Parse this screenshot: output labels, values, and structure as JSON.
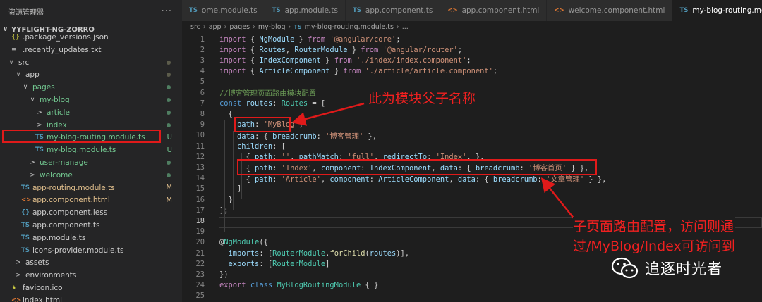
{
  "sidebar": {
    "title": "资源管理器",
    "more": "···",
    "project": "YYFLIGHT-NG-ZORRO",
    "items": [
      {
        "label": ".package_versions.json",
        "icon": "{}",
        "icon_class": "ico-json",
        "indent": 16,
        "status": ""
      },
      {
        "label": ".recently_updates.txt",
        "icon": "≡",
        "icon_class": "ico-txt",
        "indent": 16,
        "status": ""
      },
      {
        "label": "src",
        "chev": "∨",
        "icon": "",
        "icon_class": "",
        "indent": 10,
        "status": "",
        "dot": "dim",
        "label_class": ""
      },
      {
        "label": "app",
        "chev": "∨",
        "icon": "",
        "indent": 20,
        "dot": "dim"
      },
      {
        "label": "pages",
        "chev": "∨",
        "icon": "",
        "indent": 30,
        "dot": "green",
        "label_class": "c-green"
      },
      {
        "label": "my-blog",
        "chev": "∨",
        "icon": "",
        "indent": 40,
        "dot": "green",
        "label_class": "c-green"
      },
      {
        "label": "article",
        "chev": ">",
        "icon": "",
        "indent": 50,
        "dot": "green",
        "label_class": "c-green"
      },
      {
        "label": "index",
        "chev": ">",
        "icon": "",
        "indent": 50,
        "dot": "green",
        "label_class": "c-green"
      },
      {
        "label": "my-blog-routing.module.ts",
        "icon": "TS",
        "icon_class": "ico-ts",
        "indent": 50,
        "status": "U",
        "label_class": "c-green",
        "status_class": "c-green"
      },
      {
        "label": "my-blog.module.ts",
        "icon": "TS",
        "icon_class": "ico-ts",
        "indent": 50,
        "status": "U",
        "label_class": "c-green",
        "status_class": "c-green"
      },
      {
        "label": "user-manage",
        "chev": ">",
        "icon": "",
        "indent": 40,
        "dot": "green",
        "label_class": "c-green"
      },
      {
        "label": "welcome",
        "chev": ">",
        "icon": "",
        "indent": 40,
        "dot": "green",
        "label_class": "c-green"
      },
      {
        "label": "app-routing.module.ts",
        "icon": "TS",
        "icon_class": "ico-ts",
        "indent": 30,
        "status": "M",
        "label_class": "c-yellow",
        "status_class": "c-yellow"
      },
      {
        "label": "app.component.html",
        "icon": "<>",
        "icon_class": "ico-html",
        "indent": 30,
        "status": "M",
        "label_class": "c-yellow",
        "status_class": "c-yellow"
      },
      {
        "label": "app.component.less",
        "icon": "{}",
        "icon_class": "ico-css",
        "indent": 30,
        "status": ""
      },
      {
        "label": "app.component.ts",
        "icon": "TS",
        "icon_class": "ico-ts",
        "indent": 30,
        "status": ""
      },
      {
        "label": "app.module.ts",
        "icon": "TS",
        "icon_class": "ico-ts",
        "indent": 30,
        "status": ""
      },
      {
        "label": "icons-provider.module.ts",
        "icon": "TS",
        "icon_class": "ico-ts",
        "indent": 30,
        "status": ""
      },
      {
        "label": "assets",
        "chev": ">",
        "icon": "",
        "indent": 20,
        "status": ""
      },
      {
        "label": "environments",
        "chev": ">",
        "icon": "",
        "indent": 20,
        "status": ""
      },
      {
        "label": "favicon.ico",
        "icon": "★",
        "icon_class": "ico-star",
        "indent": 16,
        "status": ""
      },
      {
        "label": "index.html",
        "icon": "<>",
        "icon_class": "ico-html",
        "indent": 16,
        "status": ""
      }
    ]
  },
  "tabs": [
    {
      "label": "ome.module.ts",
      "icon": "TS",
      "icon_class": "ico-ts",
      "active": false
    },
    {
      "label": "app.module.ts",
      "icon": "TS",
      "icon_class": "ico-ts",
      "active": false
    },
    {
      "label": "app.component.ts",
      "icon": "TS",
      "icon_class": "ico-ts",
      "active": false
    },
    {
      "label": "app.component.html",
      "icon": "<>",
      "icon_class": "ico-html",
      "active": false
    },
    {
      "label": "welcome.component.html",
      "icon": "<>",
      "icon_class": "ico-html",
      "active": false
    },
    {
      "label": "my-blog-routing.module.ts",
      "icon": "TS",
      "icon_class": "ico-ts",
      "active": true
    }
  ],
  "breadcrumb": {
    "parts": [
      "src",
      "app",
      "pages",
      "my-blog"
    ],
    "file_icon": "TS",
    "file": "my-blog-routing.module.ts",
    "tail": "..."
  },
  "editor": {
    "current_line": 18,
    "lines": [
      {
        "n": "1",
        "t": [
          [
            "kc",
            "import"
          ],
          [
            "pn",
            " { "
          ],
          [
            "prop",
            "NgModule"
          ],
          [
            "pn",
            " } "
          ],
          [
            "kc",
            "from"
          ],
          [
            "pn",
            " "
          ],
          [
            "str",
            "'@angular/core'"
          ],
          [
            "pn",
            ";"
          ]
        ]
      },
      {
        "n": "2",
        "t": [
          [
            "kc",
            "import"
          ],
          [
            "pn",
            " { "
          ],
          [
            "prop",
            "Routes"
          ],
          [
            "pn",
            ", "
          ],
          [
            "prop",
            "RouterModule"
          ],
          [
            "pn",
            " } "
          ],
          [
            "kc",
            "from"
          ],
          [
            "pn",
            " "
          ],
          [
            "str",
            "'@angular/router'"
          ],
          [
            "pn",
            ";"
          ]
        ]
      },
      {
        "n": "3",
        "t": [
          [
            "kc",
            "import"
          ],
          [
            "pn",
            " { "
          ],
          [
            "prop",
            "IndexComponent"
          ],
          [
            "pn",
            " } "
          ],
          [
            "kc",
            "from"
          ],
          [
            "pn",
            " "
          ],
          [
            "str",
            "'./index/index.component'"
          ],
          [
            "pn",
            ";"
          ]
        ]
      },
      {
        "n": "4",
        "t": [
          [
            "kc",
            "import"
          ],
          [
            "pn",
            " { "
          ],
          [
            "prop",
            "ArticleComponent"
          ],
          [
            "pn",
            " } "
          ],
          [
            "kc",
            "from"
          ],
          [
            "pn",
            " "
          ],
          [
            "str",
            "'./article/article.component'"
          ],
          [
            "pn",
            ";"
          ]
        ]
      },
      {
        "n": "5",
        "t": []
      },
      {
        "n": "6",
        "t": [
          [
            "cmt",
            "//博客管理页面路由模块配置"
          ]
        ]
      },
      {
        "n": "7",
        "t": [
          [
            "kw",
            "const"
          ],
          [
            "pn",
            " "
          ],
          [
            "prop",
            "routes"
          ],
          [
            "pn",
            ": "
          ],
          [
            "ty",
            "Routes"
          ],
          [
            "pn",
            " = ["
          ]
        ]
      },
      {
        "n": "8",
        "t": [
          [
            "pn",
            "  {"
          ]
        ]
      },
      {
        "n": "9",
        "t": [
          [
            "pn",
            "    "
          ],
          [
            "prop",
            "path"
          ],
          [
            "pn",
            ": "
          ],
          [
            "str",
            "'MyBlog'"
          ],
          [
            "pn",
            ","
          ]
        ]
      },
      {
        "n": "10",
        "t": [
          [
            "pn",
            "    "
          ],
          [
            "prop",
            "data"
          ],
          [
            "pn",
            ": { "
          ],
          [
            "prop",
            "breadcrumb"
          ],
          [
            "pn",
            ": "
          ],
          [
            "str",
            "'博客管理'"
          ],
          [
            "pn",
            " },"
          ]
        ]
      },
      {
        "n": "11",
        "t": [
          [
            "pn",
            "    "
          ],
          [
            "prop",
            "children"
          ],
          [
            "pn",
            ": ["
          ]
        ]
      },
      {
        "n": "12",
        "t": [
          [
            "pn",
            "      { "
          ],
          [
            "prop",
            "path"
          ],
          [
            "pn",
            ": "
          ],
          [
            "str",
            "''"
          ],
          [
            "pn",
            ", "
          ],
          [
            "prop",
            "pathMatch"
          ],
          [
            "pn",
            ": "
          ],
          [
            "str",
            "'full'"
          ],
          [
            "pn",
            ", "
          ],
          [
            "prop",
            "redirectTo"
          ],
          [
            "pn",
            ": "
          ],
          [
            "str",
            "'Index'"
          ],
          [
            "pn",
            ", },"
          ]
        ]
      },
      {
        "n": "13",
        "t": [
          [
            "pn",
            "      { "
          ],
          [
            "prop",
            "path"
          ],
          [
            "pn",
            ": "
          ],
          [
            "str",
            "'Index'"
          ],
          [
            "pn",
            ", "
          ],
          [
            "prop",
            "component"
          ],
          [
            "pn",
            ": "
          ],
          [
            "prop",
            "IndexComponent"
          ],
          [
            "pn",
            ", "
          ],
          [
            "prop",
            "data"
          ],
          [
            "pn",
            ": { "
          ],
          [
            "prop",
            "breadcrumb"
          ],
          [
            "pn",
            ": "
          ],
          [
            "str",
            "'博客首页'"
          ],
          [
            "pn",
            " } },"
          ]
        ]
      },
      {
        "n": "14",
        "t": [
          [
            "pn",
            "      { "
          ],
          [
            "prop",
            "path"
          ],
          [
            "pn",
            ": "
          ],
          [
            "str",
            "'Article'"
          ],
          [
            "pn",
            ", "
          ],
          [
            "prop",
            "component"
          ],
          [
            "pn",
            ": "
          ],
          [
            "prop",
            "ArticleComponent"
          ],
          [
            "pn",
            ", "
          ],
          [
            "prop",
            "data"
          ],
          [
            "pn",
            ": { "
          ],
          [
            "prop",
            "breadcrumb"
          ],
          [
            "pn",
            ": "
          ],
          [
            "str",
            "'文章管理'"
          ],
          [
            "pn",
            " } },"
          ]
        ]
      },
      {
        "n": "15",
        "t": [
          [
            "pn",
            "    ]"
          ]
        ]
      },
      {
        "n": "16",
        "t": [
          [
            "pn",
            "  }"
          ]
        ]
      },
      {
        "n": "17",
        "t": [
          [
            "pn",
            "];"
          ]
        ]
      },
      {
        "n": "18",
        "t": []
      },
      {
        "n": "19",
        "t": []
      },
      {
        "n": "20",
        "t": [
          [
            "pn",
            "@"
          ],
          [
            "ty",
            "NgModule"
          ],
          [
            "pn",
            "({"
          ]
        ]
      },
      {
        "n": "21",
        "t": [
          [
            "pn",
            "  "
          ],
          [
            "prop",
            "imports"
          ],
          [
            "pn",
            ": ["
          ],
          [
            "ty",
            "RouterModule"
          ],
          [
            "pn",
            "."
          ],
          [
            "fn",
            "forChild"
          ],
          [
            "pn",
            "("
          ],
          [
            "prop",
            "routes"
          ],
          [
            "pn",
            ")],"
          ]
        ]
      },
      {
        "n": "22",
        "t": [
          [
            "pn",
            "  "
          ],
          [
            "prop",
            "exports"
          ],
          [
            "pn",
            ": ["
          ],
          [
            "ty",
            "RouterModule"
          ],
          [
            "pn",
            "]"
          ]
        ]
      },
      {
        "n": "23",
        "t": [
          [
            "pn",
            "})"
          ]
        ]
      },
      {
        "n": "24",
        "t": [
          [
            "kc",
            "export"
          ],
          [
            "pn",
            " "
          ],
          [
            "kw",
            "class"
          ],
          [
            "pn",
            " "
          ],
          [
            "ty",
            "MyBlogRoutingModule"
          ],
          [
            "pn",
            " { }"
          ]
        ]
      },
      {
        "n": "25",
        "t": []
      }
    ]
  },
  "annotations": {
    "parent_label": "此为模块父子名称",
    "child_label_line1": "子页面路由配置，访问则通",
    "child_label_line2": "过/MyBlog/Index可访问到"
  },
  "watermark": {
    "text": "追逐时光者"
  },
  "colors": {
    "annotation_red": "#e01a1a",
    "editor_bg": "#1e1e1e",
    "sidebar_bg": "#252526"
  }
}
